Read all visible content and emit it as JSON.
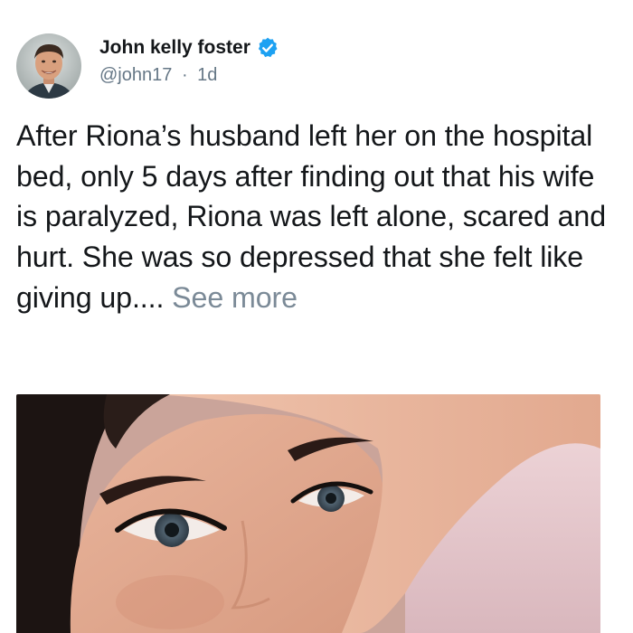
{
  "author": {
    "display_name": "John kelly foster",
    "handle": "@john17",
    "separator": "·",
    "time_ago": "1d",
    "verified": true
  },
  "tweet": {
    "text": "After Riona’s husband left her on the hospital bed, only 5 days after finding out that his wife is paralyzed, Riona was left alone, scared and hurt. She was so depressed that she felt like giving up....",
    "see_more_label": "See more"
  },
  "colors": {
    "verified_badge": "#1da1f2",
    "handle_text": "#657786",
    "see_more": "#7b8a97"
  },
  "icons": {
    "verified": "verified-badge-icon"
  }
}
